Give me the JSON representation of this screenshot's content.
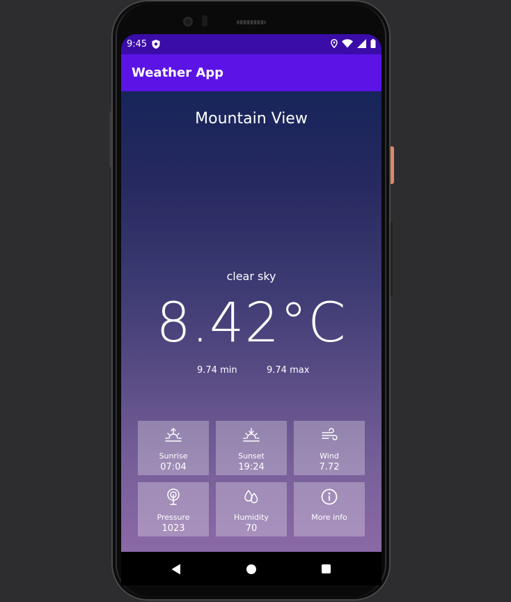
{
  "status_bar": {
    "time": "9:45",
    "icons": [
      "shield-icon",
      "location-icon",
      "wifi-icon",
      "signal-icon",
      "battery-icon"
    ]
  },
  "app_bar": {
    "title": "Weather App"
  },
  "weather": {
    "city": "Mountain View",
    "description": "clear sky",
    "temperature": "8.42°C",
    "min": "9.74 min",
    "max": "9.74 max"
  },
  "tiles": [
    {
      "icon": "sunrise-icon",
      "label": "Sunrise",
      "value": "07:04"
    },
    {
      "icon": "sunset-icon",
      "label": "Sunset",
      "value": "19:24"
    },
    {
      "icon": "wind-icon",
      "label": "Wind",
      "value": "7.72"
    },
    {
      "icon": "pressure-icon",
      "label": "Pressure",
      "value": "1023"
    },
    {
      "icon": "humidity-icon",
      "label": "Humidity",
      "value": "70"
    },
    {
      "icon": "info-icon",
      "label": "More info",
      "value": ""
    }
  ],
  "nav_bar": {
    "buttons": [
      "back-icon",
      "home-icon",
      "recents-icon"
    ]
  },
  "colors": {
    "status_bar": "#3a0ca8",
    "app_bar": "#5c13e6",
    "gradient_top": "#17255a",
    "gradient_bottom": "#8b68a6"
  }
}
